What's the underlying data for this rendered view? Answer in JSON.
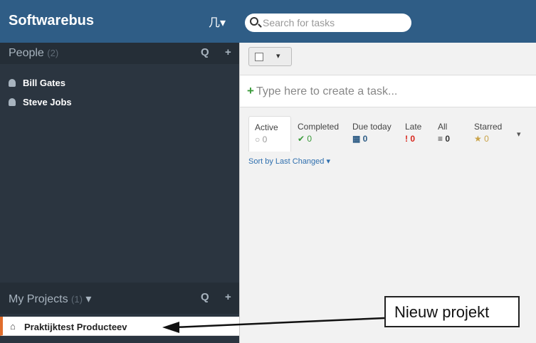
{
  "header": {
    "app_name": "Softwarebus",
    "org_icon_label": "⼏▾",
    "search_placeholder": "Search for tasks"
  },
  "sidebar": {
    "people": {
      "title": "People",
      "count": "(2)",
      "search_icon": "Q",
      "add_icon": "+",
      "items": [
        {
          "name": "Bill Gates"
        },
        {
          "name": "Steve Jobs"
        }
      ]
    },
    "projects": {
      "title": "My Projects",
      "count": "(1)",
      "dropdown_icon": "▾",
      "search_icon": "Q",
      "add_icon": "+",
      "items": [
        {
          "name": "Praktijktest Producteev",
          "icon": "home-icon"
        }
      ]
    }
  },
  "main": {
    "view_caret": "▾",
    "task_input_plus": "+",
    "task_input_placeholder": "Type here to create a task...",
    "filters": [
      {
        "label": "Active",
        "value": "○ 0"
      },
      {
        "label": "Completed",
        "value": "✔ 0"
      },
      {
        "label": "Due today",
        "value": "▦ 0"
      },
      {
        "label": "Late",
        "value": "! 0"
      },
      {
        "label": "All",
        "value": "≡ 0"
      },
      {
        "label": "Starred",
        "value": "★ 0"
      }
    ],
    "filters_more": "▾",
    "sort_label": "Sort by Last Changed ▾"
  },
  "annotation": {
    "callout_text": "Nieuw projekt"
  },
  "colors": {
    "header_bg": "#2f5d86",
    "sidebar_bg": "#2b3540",
    "project_accent": "#e06d2c"
  }
}
